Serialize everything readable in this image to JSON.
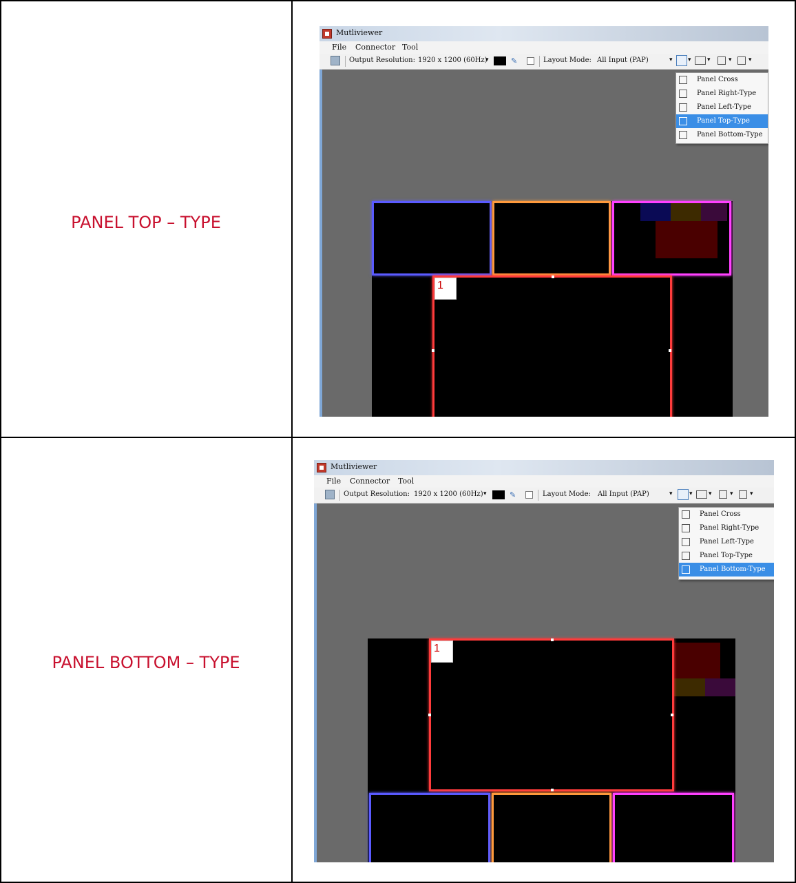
{
  "rows": [
    {
      "label": "PANEL TOP – TYPE",
      "window": {
        "title": "Mutliviewer",
        "menu": [
          "File",
          "Connector",
          "Tool"
        ],
        "toolbar": {
          "output_resolution_label": "Output Resolution:",
          "output_resolution_value": "1920 x 1200 (60Hz)",
          "layout_mode_label": "Layout Mode:",
          "layout_mode_value": "All Input (PAP)"
        },
        "dropdown_items": [
          "Panel Cross",
          "Panel Right-Type",
          "Panel Left-Type",
          "Panel Top-Type",
          "Panel Bottom-Type"
        ],
        "selected_item": "Panel Top-Type",
        "main_panel_number": "1"
      }
    },
    {
      "label": "PANEL BOTTOM – TYPE",
      "window": {
        "title": "Mutliviewer",
        "menu": [
          "File",
          "Connector",
          "Tool"
        ],
        "toolbar": {
          "output_resolution_label": "Output Resolution:",
          "output_resolution_value": "1920 x 1200 (60Hz)",
          "layout_mode_label": "Layout Mode:",
          "layout_mode_value": "All Input (PAP)"
        },
        "dropdown_items": [
          "Panel Cross",
          "Panel Right-Type",
          "Panel Left-Type",
          "Panel Top-Type",
          "Panel Bottom-Type"
        ],
        "selected_item": "Panel Bottom-Type",
        "main_panel_number": "1"
      }
    }
  ],
  "colors": {
    "label_red": "#c8102e",
    "panel_blue": "#5a5aff",
    "panel_orange": "#ff9a3c",
    "panel_pink": "#ff40ff",
    "panel_main_red": "#ff3b3b",
    "menu_highlight": "#3a8ee6"
  }
}
